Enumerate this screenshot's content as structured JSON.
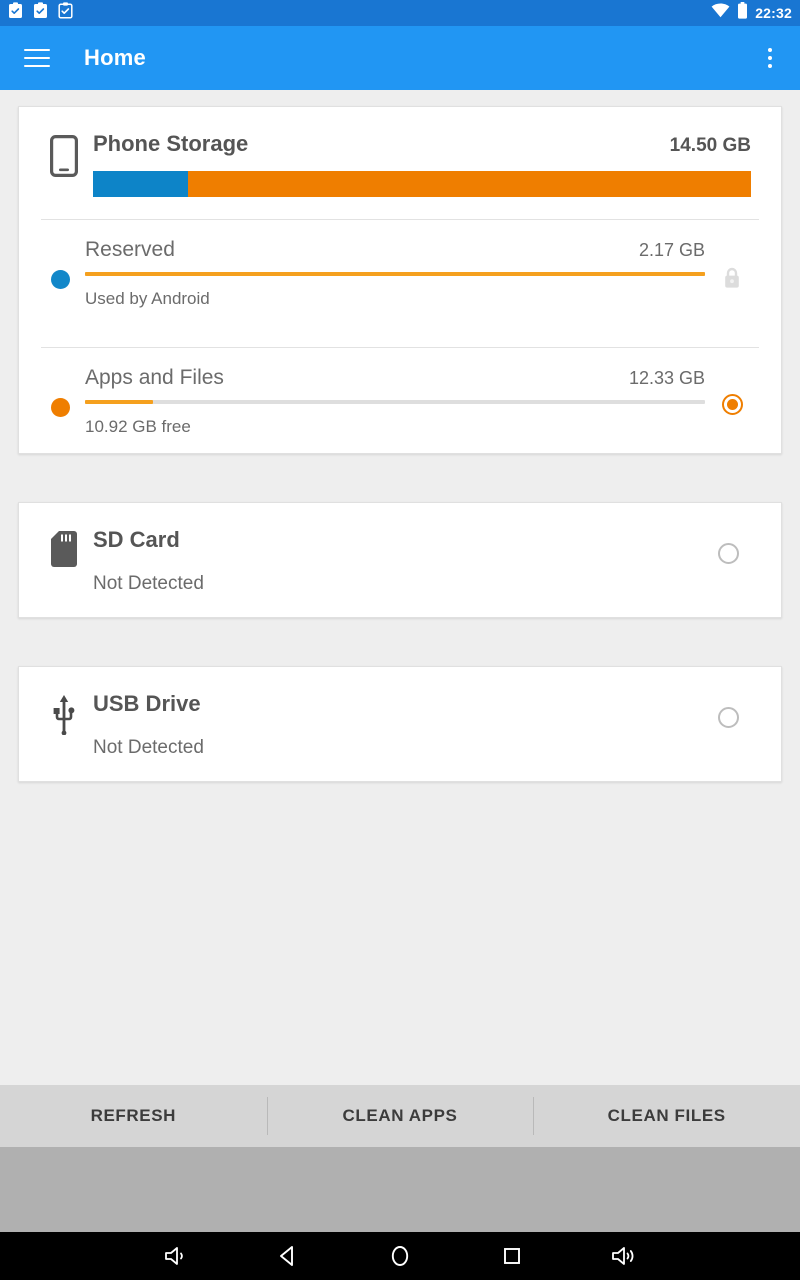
{
  "status_bar": {
    "icons": [
      "clipboard-filled-icon",
      "clipboard-filled-icon",
      "clipboard-outline-icon"
    ],
    "wifi_icon": "wifi-icon",
    "battery_icon": "battery-icon",
    "time": "22:32",
    "background": "#1976d2"
  },
  "app_bar": {
    "menu_icon": "hamburger-menu-icon",
    "title": "Home",
    "overflow_icon": "more-vert-icon",
    "background": "#2196f3"
  },
  "colors": {
    "accent_blue": "#0d84c8",
    "accent_orange": "#ef7e00",
    "track": "#dedede",
    "page_bg": "#eeeeee"
  },
  "phone_storage": {
    "icon": "smartphone-icon",
    "title": "Phone Storage",
    "total": "14.50 GB",
    "segments": [
      {
        "name": "reserved",
        "color": "#0d84c8",
        "percent": 14.4
      },
      {
        "name": "apps-and-files",
        "color": "#ef7e00",
        "percent": 85.6
      }
    ],
    "rows": [
      {
        "dot_color": "#1287c9",
        "title": "Reserved",
        "value": "2.17 GB",
        "note": "Used by Android",
        "fill_percent": 100,
        "trailing": "lock-icon",
        "selected": false
      },
      {
        "dot_color": "#ef7e00",
        "title": "Apps and Files",
        "value": "12.33 GB",
        "note": "10.92 GB free",
        "fill_percent": 11,
        "trailing": "radio-button",
        "selected": true
      }
    ]
  },
  "devices": [
    {
      "icon": "sd-card-icon",
      "title": "SD Card",
      "status": "Not Detected",
      "selected": false
    },
    {
      "icon": "usb-drive-icon",
      "title": "USB Drive",
      "status": "Not Detected",
      "selected": false
    }
  ],
  "action_bar": {
    "buttons": [
      {
        "label": "REFRESH"
      },
      {
        "label": "CLEAN APPS"
      },
      {
        "label": "CLEAN FILES"
      }
    ]
  },
  "nav_bar": {
    "buttons": [
      {
        "name": "volume-down-icon"
      },
      {
        "name": "back-icon"
      },
      {
        "name": "home-icon"
      },
      {
        "name": "recents-icon"
      },
      {
        "name": "volume-up-icon"
      }
    ]
  }
}
